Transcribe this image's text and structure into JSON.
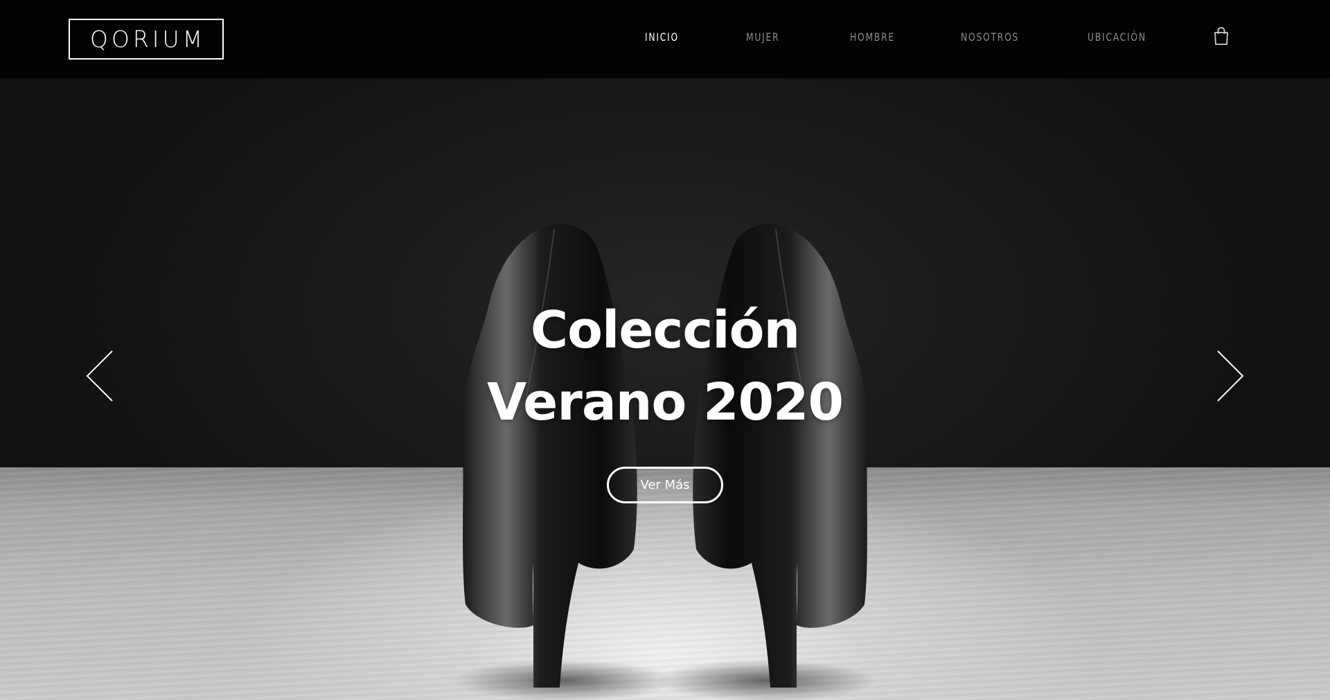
{
  "header": {
    "logo_text": "QORIUM",
    "nav": [
      {
        "label": "INICIO",
        "active": true
      },
      {
        "label": "MUJER",
        "active": false
      },
      {
        "label": "HOMBRE",
        "active": false
      },
      {
        "label": "NOSOTROS",
        "active": false
      },
      {
        "label": "UBICACIÓN",
        "active": false
      }
    ],
    "cart_icon": "shopping-bag-icon"
  },
  "hero": {
    "title_line1": "Colección",
    "title_line2": "Verano 2020",
    "cta_label": "Ver Más",
    "prev_icon": "chevron-left-icon",
    "next_icon": "chevron-right-icon"
  },
  "colors": {
    "header_bg": "#030303",
    "nav_active": "#ffffff",
    "nav_inactive": "#8d8d8d",
    "text_light": "#ffffff"
  }
}
